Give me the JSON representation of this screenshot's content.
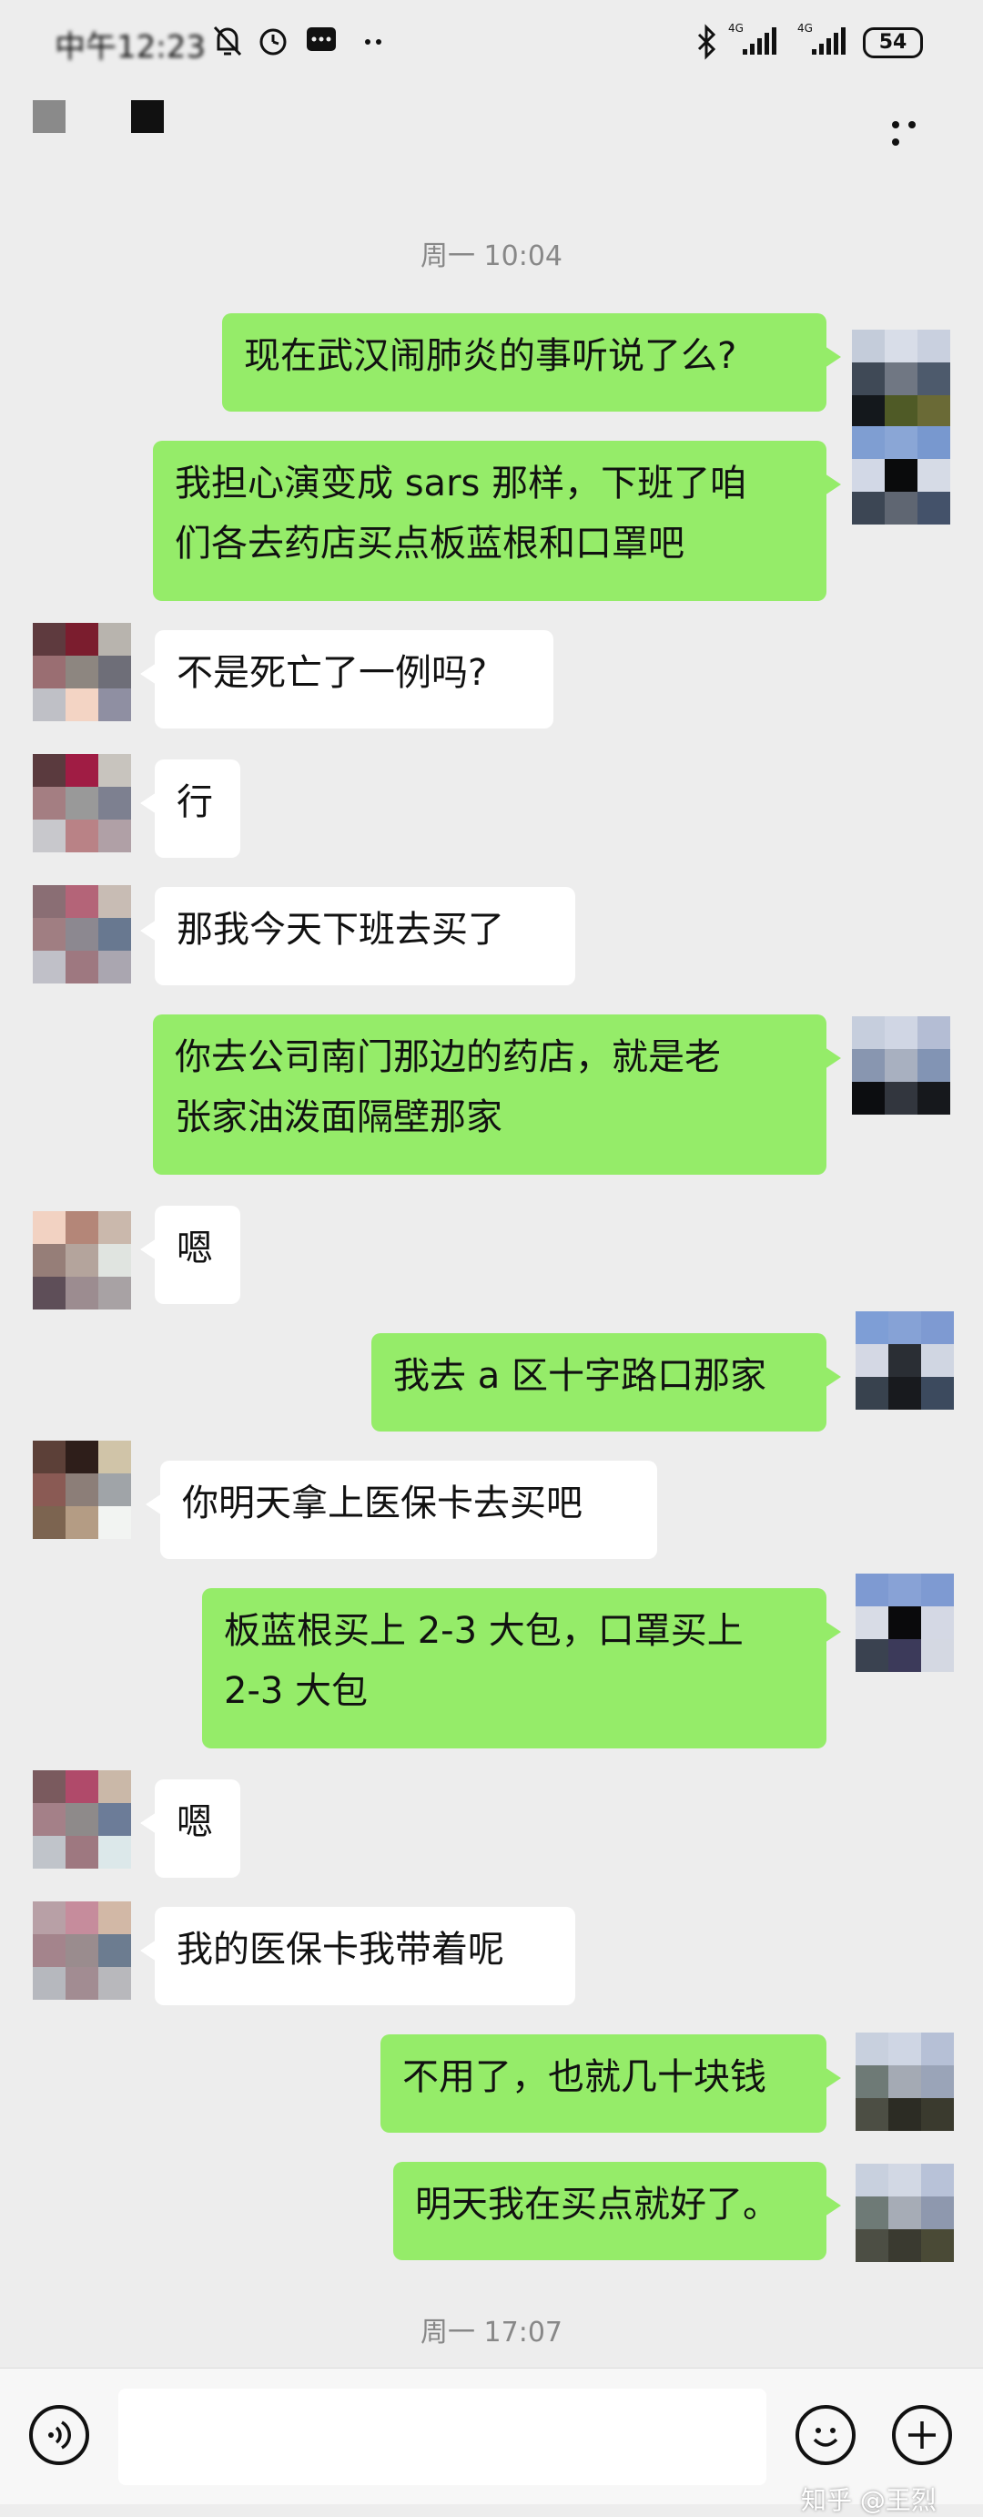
{
  "status_bar": {
    "time": "中午12:23",
    "network_left": "4G",
    "network_right": "4G",
    "battery": "54"
  },
  "title_bar": {
    "more_label": "···"
  },
  "messages": [
    {
      "type": "timestamp",
      "text": "周一 10:04"
    },
    {
      "type": "me",
      "lines": [
        "现在武汉闹肺炎的事听说了么?"
      ]
    },
    {
      "type": "me",
      "lines": [
        "我担心演变成 sars 那样，下班了咱",
        "们各去药店买点板蓝根和口罩吧"
      ]
    },
    {
      "type": "other",
      "lines": [
        "不是死亡了一例吗?"
      ]
    },
    {
      "type": "other",
      "lines": [
        "行"
      ]
    },
    {
      "type": "other",
      "lines": [
        "那我今天下班去买了"
      ]
    },
    {
      "type": "me",
      "lines": [
        "你去公司南门那边的药店，就是老",
        "张家油泼面隔壁那家"
      ]
    },
    {
      "type": "other",
      "lines": [
        "嗯"
      ]
    },
    {
      "type": "me",
      "lines": [
        "我去 a 区十字路口那家"
      ]
    },
    {
      "type": "other",
      "lines": [
        "你明天拿上医保卡去买吧"
      ]
    },
    {
      "type": "me",
      "lines": [
        "板蓝根买上 2-3 大包，口罩买上",
        "2-3 大包"
      ]
    },
    {
      "type": "other",
      "lines": [
        "嗯"
      ]
    },
    {
      "type": "other",
      "lines": [
        "我的医保卡我带着呢"
      ]
    },
    {
      "type": "me",
      "lines": [
        "不用了，也就几十块钱"
      ]
    },
    {
      "type": "me",
      "lines": [
        "明天我在买点就好了。"
      ]
    },
    {
      "type": "timestamp",
      "text": "周一 17:07"
    }
  ],
  "input_bar": {
    "placeholder": ""
  },
  "watermark": "知乎 @王烈",
  "colors": {
    "my_bubble": "#95ec69",
    "other_bubble": "#ffffff",
    "background": "#ededed"
  }
}
